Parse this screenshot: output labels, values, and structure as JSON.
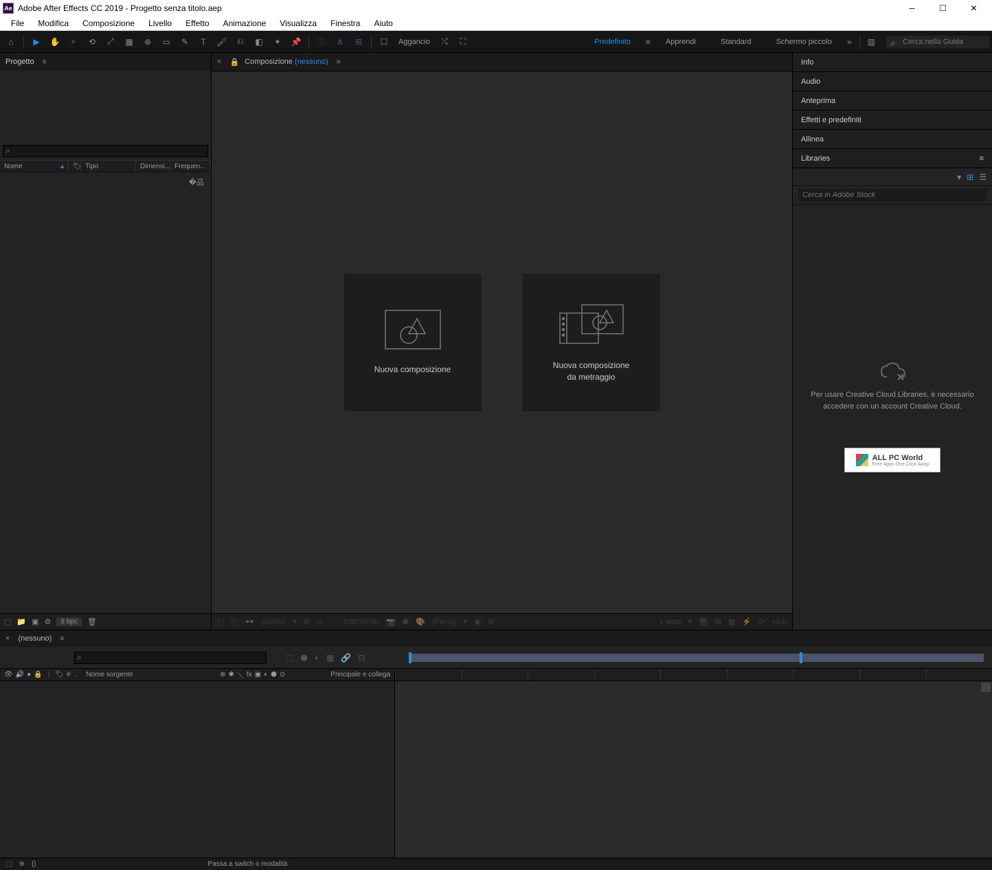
{
  "titlebar": {
    "app_icon_text": "Ae",
    "title": "Adobe After Effects CC 2019 - Progetto senza titolo.aep"
  },
  "menubar": [
    "File",
    "Modifica",
    "Composizione",
    "Livello",
    "Effetto",
    "Animazione",
    "Visualizza",
    "Finestra",
    "Aiuto"
  ],
  "toolbar": {
    "snap_label": "Aggancio",
    "workspaces": {
      "active": "Predefinito",
      "others": [
        "Apprendi",
        "Standard",
        "Schermo piccolo"
      ]
    },
    "search_placeholder": "Cerca nella Guida"
  },
  "project_panel": {
    "tab": "Progetto",
    "columns": [
      "Nome",
      "Tipo",
      "Dimensi...",
      "Frequen..."
    ],
    "bpc_label": "8 bpc"
  },
  "composition_panel": {
    "tab_prefix": "Composizione",
    "tab_none": "(nessuno)",
    "card1": "Nuova composizione",
    "card2_line1": "Nuova composizione",
    "card2_line2": "da metraggio",
    "footer": {
      "zoom": "(100%)",
      "timecode": "0:00:00:00",
      "res": "(Piena)",
      "views": "1 vista",
      "exposure": "+0,0"
    }
  },
  "right_panels": {
    "items": [
      "Info",
      "Audio",
      "Anteprima",
      "Effetti e predefiniti",
      "Allinea"
    ],
    "libraries": {
      "title": "Libraries",
      "search_placeholder": "Cerca in Adobe Stock",
      "message": "Per usare Creative Cloud Libraries, è necessario accedere con un account Creative Cloud.",
      "watermark_text": "ALL PC World",
      "watermark_sub": "Free Apps One Click Away"
    }
  },
  "timeline": {
    "tab": "(nessuno)",
    "col_label1": "Nome sorgente",
    "col_label2": "Principale e collega"
  },
  "statusbar": {
    "message": "Passa a switch o modalità"
  }
}
